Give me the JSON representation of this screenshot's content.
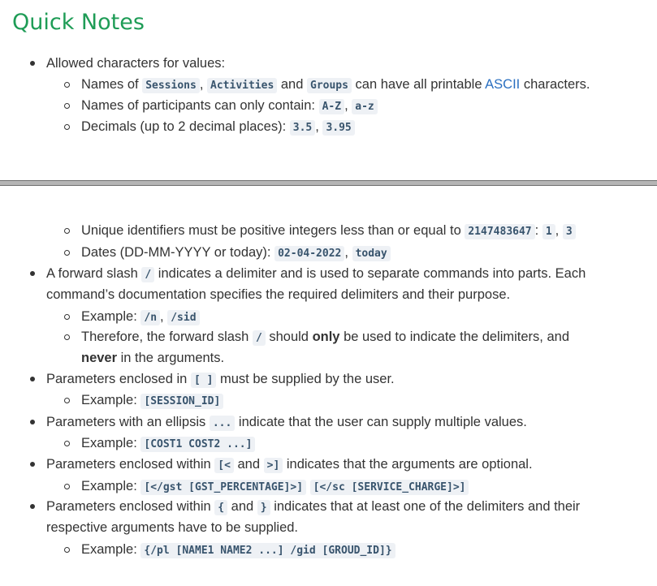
{
  "title": "Quick Notes",
  "top": {
    "l1": "Allowed characters for values:",
    "l2": {
      "a": "Names of ",
      "c1": "Sessions",
      "s1": ",",
      "c2": "Activities",
      "s2": " and ",
      "c3": "Groups",
      "s3": " can have all printable ",
      "link": "ASCII",
      "s4": " characters."
    },
    "l3": {
      "a": "Names of participants can only contain: ",
      "c1": "A-Z",
      "s1": ",",
      "c2": "a-z"
    },
    "l4": {
      "a": "Decimals (up to 2 decimal places): ",
      "c1": "3.5",
      "s1": ",",
      "c2": "3.95"
    }
  },
  "bottom": {
    "l1": {
      "a": "Unique identifiers must be positive integers less than or equal to ",
      "c1": "2147483647",
      "s1": ":",
      "c2": "1",
      "s2": ",",
      "c3": "3"
    },
    "l2": {
      "a": "Dates (DD-MM-YYYY or today): ",
      "c1": "02-04-2022",
      "s1": ",",
      "c2": "today"
    },
    "l3": {
      "a": "A forward slash ",
      "c1": "/",
      "b": " indicates a delimiter and is used to separate commands into parts. Each"
    },
    "l3b": "command’s documentation specifies the required delimiters and their purpose.",
    "l4": {
      "a": "Example: ",
      "c1": "/n",
      "s1": ",",
      "c2": "/sid"
    },
    "l5": {
      "a": "Therefore, the forward slash ",
      "c1": "/",
      "b": " should ",
      "bold": "only",
      "c": " be used to indicate the delimiters, and"
    },
    "l5b": {
      "bold": "never",
      "a": " in the arguments."
    },
    "l6": {
      "a": "Parameters enclosed in ",
      "c1": "[ ]",
      "b": " must be supplied by the user."
    },
    "l7": {
      "a": "Example: ",
      "c1": "[SESSION_ID]"
    },
    "l8": {
      "a": "Parameters with an ellipsis ",
      "c1": "...",
      "b": " indicate that the user can supply multiple values."
    },
    "l9": {
      "a": "Example: ",
      "c1": "[COST1 COST2 ...]"
    },
    "l10": {
      "a": "Parameters enclosed within ",
      "c1": "[<",
      "b": " and ",
      "c2": ">]",
      "c": " indicates that the arguments are optional."
    },
    "l11": {
      "a": "Example: ",
      "c1": "[</gst [GST_PERCENTAGE]>]",
      "c2": "[</sc [SERVICE_CHARGE]>]"
    },
    "l12": {
      "a": "Parameters enclosed within ",
      "c1": "{",
      "b": " and ",
      "c2": "}",
      "c": " indicates that at least one of the delimiters and their"
    },
    "l12b": "respective arguments have to be supplied.",
    "l13": {
      "a": "Example: ",
      "c1": "{/pl [NAME1 NAME2 ...] /gid [GROUD_ID]}"
    }
  }
}
